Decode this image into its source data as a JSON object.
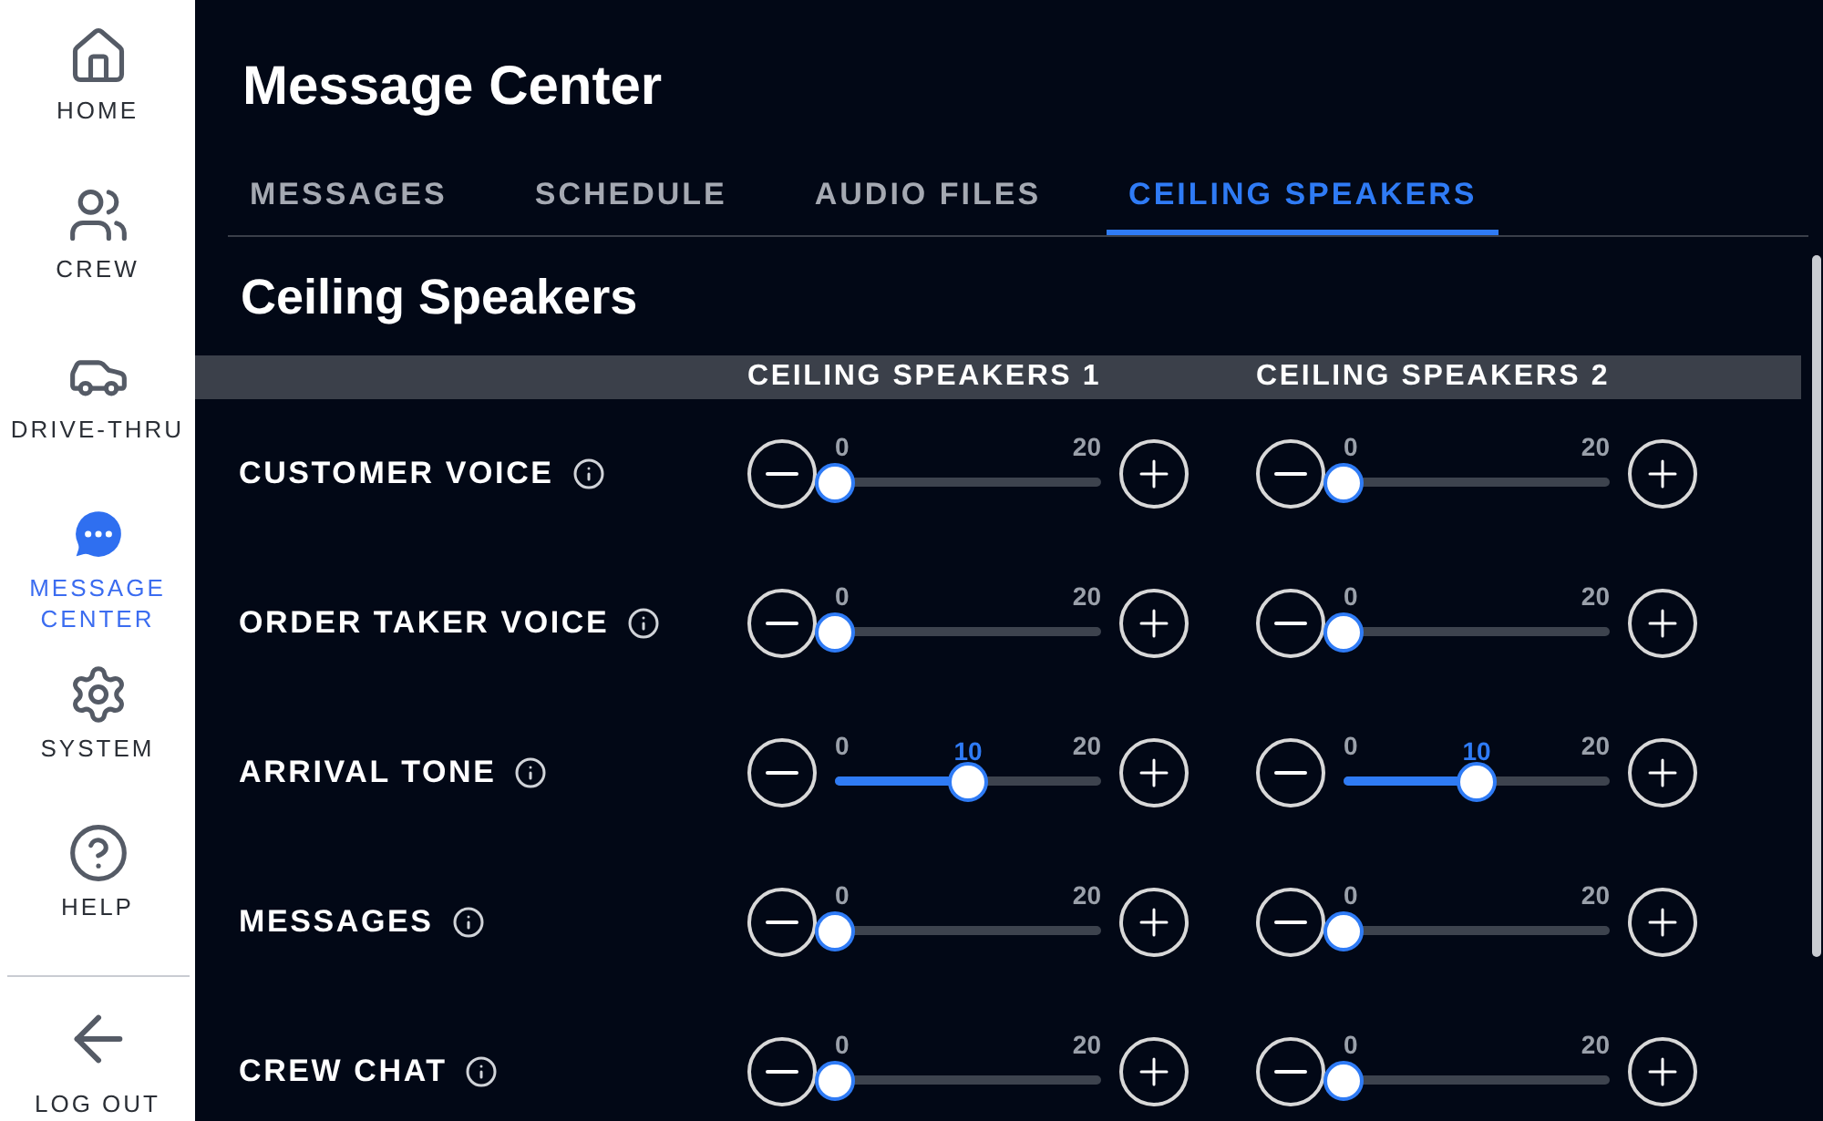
{
  "sidebar": {
    "items": [
      {
        "kind": "home",
        "label": "HOME",
        "selected": false
      },
      {
        "kind": "crew",
        "label": "CREW",
        "selected": false
      },
      {
        "kind": "drive",
        "label": "DRIVE-THRU",
        "selected": false
      },
      {
        "kind": "message",
        "label": "MESSAGE CENTER",
        "selected": true
      },
      {
        "kind": "system",
        "label": "SYSTEM",
        "selected": false
      },
      {
        "kind": "help",
        "label": "HELP",
        "selected": false
      }
    ],
    "logout": {
      "label": "LOG OUT"
    }
  },
  "title": "Message Center",
  "tabs": [
    {
      "label": "MESSAGES",
      "selected": false
    },
    {
      "label": "SCHEDULE",
      "selected": false
    },
    {
      "label": "AUDIO FILES",
      "selected": false
    },
    {
      "label": "CEILING SPEAKERS",
      "selected": true
    }
  ],
  "section_title": "Ceiling Speakers",
  "table": {
    "columns": [
      "CEILING SPEAKERS 1",
      "CEILING SPEAKERS 2"
    ],
    "rows": [
      {
        "label": "CUSTOMER VOICE",
        "sliders": [
          {
            "min": "0",
            "max": "20",
            "level": 0
          },
          {
            "min": "0",
            "max": "20",
            "level": 0
          }
        ]
      },
      {
        "label": "ORDER TAKER VOICE",
        "sliders": [
          {
            "min": "0",
            "max": "20",
            "level": 0
          },
          {
            "min": "0",
            "max": "20",
            "level": 0
          }
        ]
      },
      {
        "label": "ARRIVAL TONE",
        "sliders": [
          {
            "min": "0",
            "max": "20",
            "value": "10",
            "level": 0.5
          },
          {
            "min": "0",
            "max": "20",
            "value": "10",
            "level": 0.5
          }
        ]
      },
      {
        "label": "MESSAGES",
        "sliders": [
          {
            "min": "0",
            "max": "20",
            "level": 0
          },
          {
            "min": "0",
            "max": "20",
            "level": 0
          }
        ]
      },
      {
        "label": "CREW CHAT",
        "sliders": [
          {
            "min": "0",
            "max": "20",
            "level": 0
          },
          {
            "min": "0",
            "max": "20",
            "level": 0
          }
        ]
      }
    ]
  }
}
